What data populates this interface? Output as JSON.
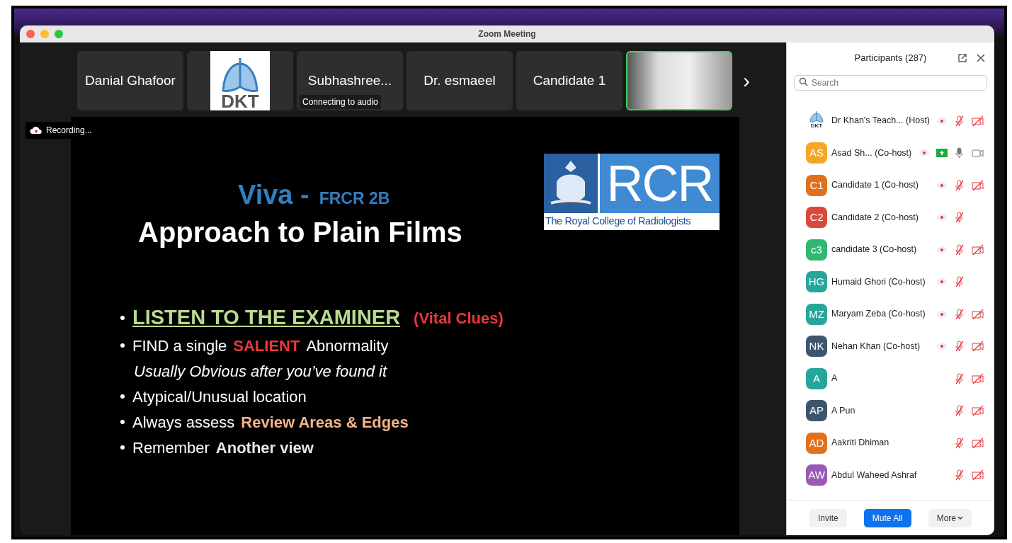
{
  "window": {
    "title": "Zoom Meeting"
  },
  "thumbnails": [
    {
      "kind": "name",
      "name": "Danial Ghafoor"
    },
    {
      "kind": "logo",
      "text": "DKT"
    },
    {
      "kind": "name",
      "name": "Subhashree...",
      "status": "Connecting to audio"
    },
    {
      "kind": "name",
      "name": "Dr. esmaeel"
    },
    {
      "kind": "name",
      "name": "Candidate 1"
    },
    {
      "kind": "video",
      "speaking": true
    }
  ],
  "next_arrow": "›",
  "recording_badge": "Recording...",
  "slide": {
    "title": "Viva -",
    "subtitle": "FRCR 2B",
    "heading": "Approach to Plain Films",
    "logo": {
      "initials": "RCR",
      "caption": "The Royal College of Radiologists"
    },
    "lines": [
      {
        "bullet": true,
        "parts": [
          {
            "kind": "underline",
            "text": "LISTEN TO THE EXAMINER"
          },
          {
            "kind": "red-note",
            "text": "(Vital Clues)"
          }
        ]
      },
      {
        "bullet": true,
        "parts": [
          {
            "kind": "plain",
            "text": "FIND a single"
          },
          {
            "kind": "red",
            "text": "SALIENT"
          },
          {
            "kind": "plain",
            "text": "Abnormality"
          }
        ]
      },
      {
        "bullet": false,
        "parts": [
          {
            "kind": "italic",
            "text": "Usually Obvious after you’ve found it"
          }
        ]
      },
      {
        "bullet": true,
        "parts": [
          {
            "kind": "plain",
            "text": "Atypical/Unusual location"
          }
        ]
      },
      {
        "bullet": true,
        "parts": [
          {
            "kind": "plain",
            "text": "Always assess"
          },
          {
            "kind": "peach",
            "text": "Review Areas & Edges"
          }
        ]
      },
      {
        "bullet": true,
        "parts": [
          {
            "kind": "plain",
            "text": "Remember"
          },
          {
            "kind": "bold",
            "text": "Another view"
          }
        ]
      }
    ]
  },
  "participants": {
    "title": "Participants (287)",
    "search": {
      "placeholder": "Search"
    },
    "rows": [
      {
        "avatar": {
          "kind": "logo",
          "text": "DKT"
        },
        "name": "Dr Khan's Teach... (Host)",
        "recording": true,
        "screen_share": false,
        "mic_muted": true,
        "video_off": true
      },
      {
        "avatar": {
          "kind": "initials",
          "text": "AS",
          "color": "#f5a623"
        },
        "name": "Asad Sh... (Co-host)",
        "recording": true,
        "screen_share": true,
        "mic_muted": false,
        "video_off": false
      },
      {
        "avatar": {
          "kind": "initials",
          "text": "C1",
          "color": "#e2711d"
        },
        "name": "Candidate 1 (Co-host)",
        "recording": true,
        "screen_share": false,
        "mic_muted": true,
        "video_off": true
      },
      {
        "avatar": {
          "kind": "initials",
          "text": "C2",
          "color": "#d9493a"
        },
        "name": "Candidate 2 (Co-host)",
        "recording": true,
        "screen_share": false,
        "mic_muted": true
      },
      {
        "avatar": {
          "kind": "initials",
          "text": "c3",
          "color": "#2eb872"
        },
        "name": "candidate 3 (Co-host)",
        "recording": true,
        "screen_share": false,
        "mic_muted": true,
        "video_off": true
      },
      {
        "avatar": {
          "kind": "initials",
          "text": "HG",
          "color": "#26a69a"
        },
        "name": "Humaid Ghori (Co-host)",
        "recording": true,
        "screen_share": false,
        "mic_muted": true
      },
      {
        "avatar": {
          "kind": "initials",
          "text": "MZ",
          "color": "#26a69a"
        },
        "name": "Maryam Zeba (Co-host)",
        "recording": true,
        "screen_share": false,
        "mic_muted": true,
        "video_off": true
      },
      {
        "avatar": {
          "kind": "initials",
          "text": "NK",
          "color": "#3d566e"
        },
        "name": "Nehan Khan (Co-host)",
        "recording": true,
        "screen_share": false,
        "mic_muted": true,
        "video_off": true
      },
      {
        "avatar": {
          "kind": "initials",
          "text": "A",
          "color": "#26a69a"
        },
        "name": "A",
        "recording": false,
        "screen_share": false,
        "mic_muted": true,
        "video_off": true
      },
      {
        "avatar": {
          "kind": "initials",
          "text": "AP",
          "color": "#3d566e"
        },
        "name": "A Pun",
        "recording": false,
        "screen_share": false,
        "mic_muted": true,
        "video_off": true
      },
      {
        "avatar": {
          "kind": "initials",
          "text": "AD",
          "color": "#e2711d"
        },
        "name": "Aakriti Dhiman",
        "recording": false,
        "screen_share": false,
        "mic_muted": true,
        "video_off": true
      },
      {
        "avatar": {
          "kind": "initials",
          "text": "AW",
          "color": "#9b59b6"
        },
        "name": "Abdul Waheed Ashraf",
        "recording": false,
        "screen_share": false,
        "mic_muted": true,
        "video_off": true
      }
    ],
    "buttons": [
      {
        "label": "Invite",
        "primary": false,
        "dropdown": false
      },
      {
        "label": "Mute All",
        "primary": true,
        "dropdown": false
      },
      {
        "label": "More",
        "primary": false,
        "dropdown": true
      }
    ]
  }
}
